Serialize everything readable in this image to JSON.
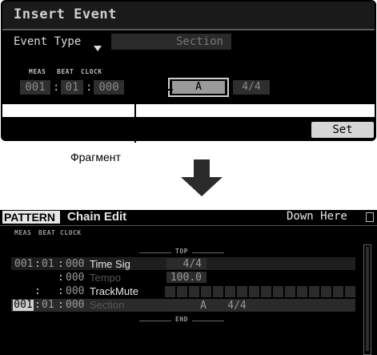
{
  "top_panel": {
    "title": "Insert Event",
    "event_type_label": "Event Type",
    "event_type_value": "Section",
    "col_headers": [
      "MEAS",
      "BEAT",
      "CLOCK"
    ],
    "meas": "001",
    "beat": "01",
    "clock": "000",
    "section_value": "A",
    "time_sig": "4/4",
    "set_label": "Set"
  },
  "caption": "Фрагмент",
  "bottom_panel": {
    "tab_label": "PATTERN",
    "title": "Chain Edit",
    "right_text": "Down Here",
    "col_headers": [
      "MEAS",
      "BEAT",
      "CLOCK"
    ],
    "top_marker": "TOP",
    "end_marker": "END",
    "rows": [
      {
        "meas": "001",
        "beat": "01",
        "clock": "000",
        "event": "Time Sig",
        "value": "4/4"
      },
      {
        "meas": "",
        "beat": "",
        "clock": "000",
        "event": "Tempo",
        "value": "100.0"
      },
      {
        "meas": "",
        "beat": "",
        "clock": "000",
        "event": "TrackMute",
        "value": ""
      },
      {
        "meas": "001",
        "beat": "01",
        "clock": "000",
        "event": "Section",
        "value": "A",
        "value2": "4/4"
      }
    ]
  },
  "colors": {
    "panel_bg": "#000000",
    "highlight": "#e6e6e6",
    "arrow": "#2b2b2b"
  }
}
